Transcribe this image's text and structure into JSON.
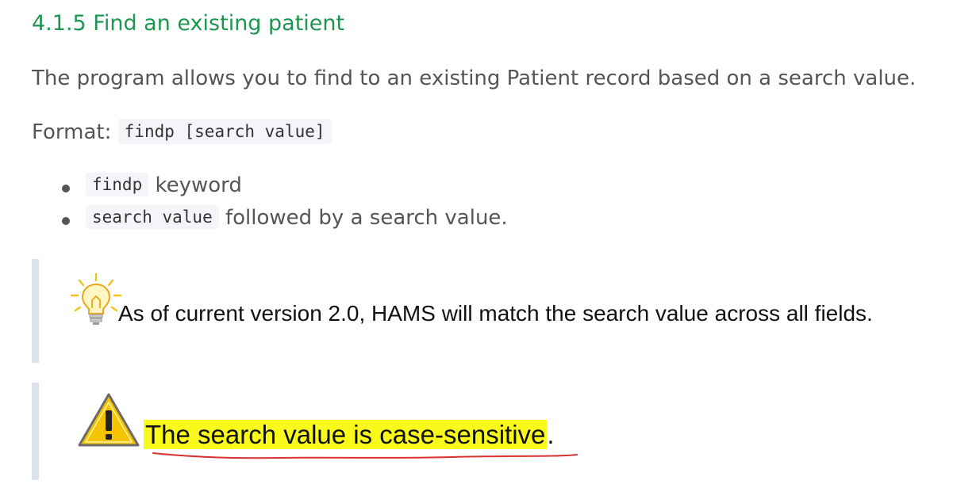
{
  "section": {
    "heading": "4.1.5 Find an existing patient"
  },
  "intro": "The program allows you to find to an existing Patient record based on a search value.",
  "format": {
    "label": "Format: ",
    "code": "findp [search value]"
  },
  "bullets": [
    {
      "code": "findp",
      "text": " keyword"
    },
    {
      "code": "search value",
      "text": " followed by a search value."
    }
  ],
  "tip": {
    "icon": "lightbulb-icon",
    "text": "As of current version 2.0, HAMS will match the search value across all fields."
  },
  "warning": {
    "icon": "warning-triangle-icon",
    "highlighted_text": "The search value is case-sensitive",
    "trailing_text": "."
  },
  "colors": {
    "heading": "#1e9651",
    "highlight": "#f9f91c",
    "callout_border": "#dde3ec",
    "underline": "#d9322e"
  }
}
